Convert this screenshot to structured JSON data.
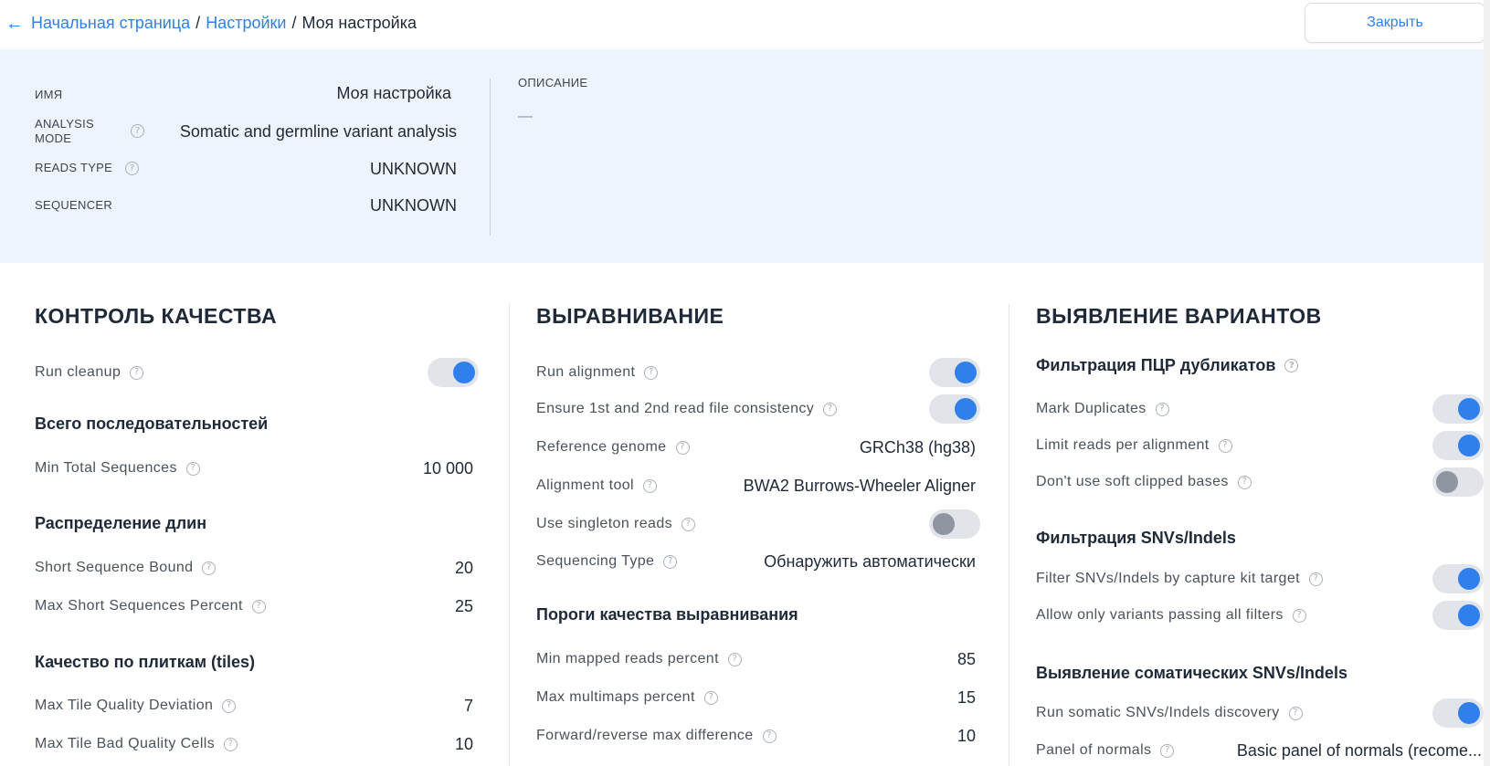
{
  "header": {
    "back_arrow": "←",
    "crumbs": [
      "Начальная страница",
      "Настройки",
      "Моя настройка"
    ],
    "separator": "/",
    "close_label": "Закрыть"
  },
  "summary": {
    "name_label": "ИМЯ",
    "name_value": "Моя настройка",
    "mode_label": "ANALYSIS MODE",
    "mode_label_line1": "ANALYSIS",
    "mode_label_line2": "MODE",
    "mode_value": "Somatic and germline variant analysis",
    "reads_label": "READS TYPE",
    "reads_value": "UNKNOWN",
    "sequencer_label": "SEQUENCER",
    "sequencer_value": "UNKNOWN",
    "description_label": "ОПИСАНИЕ",
    "description_value": "—"
  },
  "help_glyph": "?",
  "qc": {
    "title": "КОНТРОЛЬ КАЧЕСТВА",
    "run_cleanup": {
      "label": "Run cleanup",
      "enabled": true
    },
    "total_title": "Всего последовательностей",
    "min_total": {
      "label": "Min Total Sequences",
      "value": "10 000"
    },
    "length_title": "Распределение длин",
    "short_bound": {
      "label": "Short Sequence Bound",
      "value": "20"
    },
    "max_short_pct": {
      "label": "Max Short Sequences Percent",
      "value": "25"
    },
    "tiles_title": "Качество по плиткам (tiles)",
    "max_tile_dev": {
      "label": "Max Tile Quality Deviation",
      "value": "7"
    },
    "max_tile_bad": {
      "label": "Max Tile Bad Quality Cells",
      "value": "10"
    }
  },
  "alignment": {
    "title": "ВЫРАВНИВАНИЕ",
    "run_alignment": {
      "label": "Run alignment",
      "enabled": true
    },
    "ensure_consistency": {
      "label": "Ensure 1st and 2nd read file consistency",
      "enabled": true
    },
    "reference_genome": {
      "label": "Reference genome",
      "value": "GRCh38 (hg38)"
    },
    "alignment_tool": {
      "label": "Alignment tool",
      "value": "BWA2 Burrows-Wheeler Aligner"
    },
    "singleton": {
      "label": "Use singleton reads",
      "enabled": false
    },
    "seq_type": {
      "label": "Sequencing Type",
      "value": "Обнаружить автоматически"
    },
    "thresholds_title": "Пороги качества выравнивания",
    "min_mapped": {
      "label": "Min mapped reads percent",
      "value": "85"
    },
    "max_multimaps": {
      "label": "Max multimaps percent",
      "value": "15"
    },
    "fr_max_diff": {
      "label": "Forward/reverse max difference",
      "value": "10"
    }
  },
  "variants": {
    "title": "ВЫЯВЛЕНИЕ ВАРИАНТОВ",
    "pcr_title": "Фильтрация ПЦР дубликатов",
    "mark_dups": {
      "label": "Mark Duplicates",
      "enabled": true
    },
    "limit_reads": {
      "label": "Limit reads per alignment",
      "enabled": true
    },
    "soft_clipped": {
      "label": "Don't use soft clipped bases",
      "enabled": false
    },
    "snv_filter_title": "Фильтрация SNVs/Indels",
    "capture_kit": {
      "label": "Filter SNVs/Indels by capture kit target",
      "enabled": true
    },
    "passing_filters": {
      "label": "Allow only variants passing all filters",
      "enabled": true
    },
    "somatic_title": "Выявление соматических SNVs/Indels",
    "run_somatic": {
      "label": "Run somatic SNVs/Indels discovery",
      "enabled": true
    },
    "panel_normals": {
      "label": "Panel of normals",
      "value": "Basic panel of normals (recome..."
    }
  },
  "colors": {
    "accent": "#2f80ed",
    "panel_bg": "#eef4fb",
    "toggle_track": "#e1e4e8",
    "toggle_off_knob": "#8e95a0"
  }
}
